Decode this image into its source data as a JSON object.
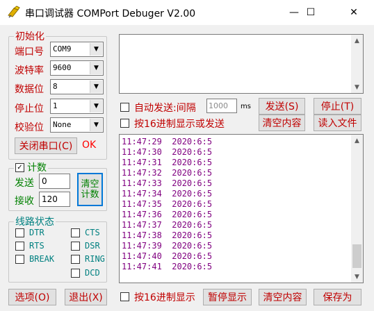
{
  "window": {
    "title": "串口调试器 COMPort Debuger V2.00",
    "minimize": "—",
    "maximize": "☐",
    "close": "✕"
  },
  "config": {
    "legend": "初始化",
    "port_label": "端口号",
    "port_value": "COM9",
    "baud_label": "波特率",
    "baud_value": "9600",
    "data_label": "数据位",
    "data_value": "8",
    "stop_label": "停止位",
    "stop_value": "1",
    "parity_label": "校验位",
    "parity_value": "None",
    "close_port_button": "关闭串口(C)",
    "status": "OK"
  },
  "send": {
    "auto_send_label": "自动发送:间隔",
    "interval_placeholder": "1000",
    "interval_unit": "ms",
    "hex_send_label": "按16进制显示或发送",
    "send_button": "发送(S)",
    "stop_button": "停止(T)",
    "clear_button": "清空内容",
    "read_file_button": "读入文件"
  },
  "counter": {
    "legend": "计数",
    "checked": true,
    "sent_label": "发送",
    "sent_value": "0",
    "recv_label": "接收",
    "recv_value": "120",
    "clear_button_line1": "清空",
    "clear_button_line2": "计数"
  },
  "line_status": {
    "legend": "线路状态",
    "pins": {
      "dtr": "DTR",
      "rts": "RTS",
      "break": "BREAK",
      "cts": "CTS",
      "dsr": "DSR",
      "ring": "RING",
      "dcd": "DCD"
    }
  },
  "receive": {
    "lines": [
      "11:47:29  2020:6:5",
      "11:47:30  2020:6:5",
      "11:47:31  2020:6:5",
      "11:47:32  2020:6:5",
      "11:47:33  2020:6:5",
      "11:47:34  2020:6:5",
      "11:47:35  2020:6:5",
      "11:47:36  2020:6:5",
      "11:47:37  2020:6:5",
      "11:47:38  2020:6:5",
      "11:47:39  2020:6:5",
      "11:47:40  2020:6:5",
      "11:47:41  2020:6:5"
    ]
  },
  "bottom": {
    "options_button": "选项(O)",
    "exit_button": "退出(X)",
    "hex_display_label": "按16进制显示",
    "pause_button": "暂停显示",
    "clear_button": "清空内容",
    "save_button": "保存为"
  },
  "colors": {
    "label_red": "#c00000",
    "counter_green": "#008000",
    "receive_purple": "#800080",
    "pin_teal": "#008080"
  }
}
